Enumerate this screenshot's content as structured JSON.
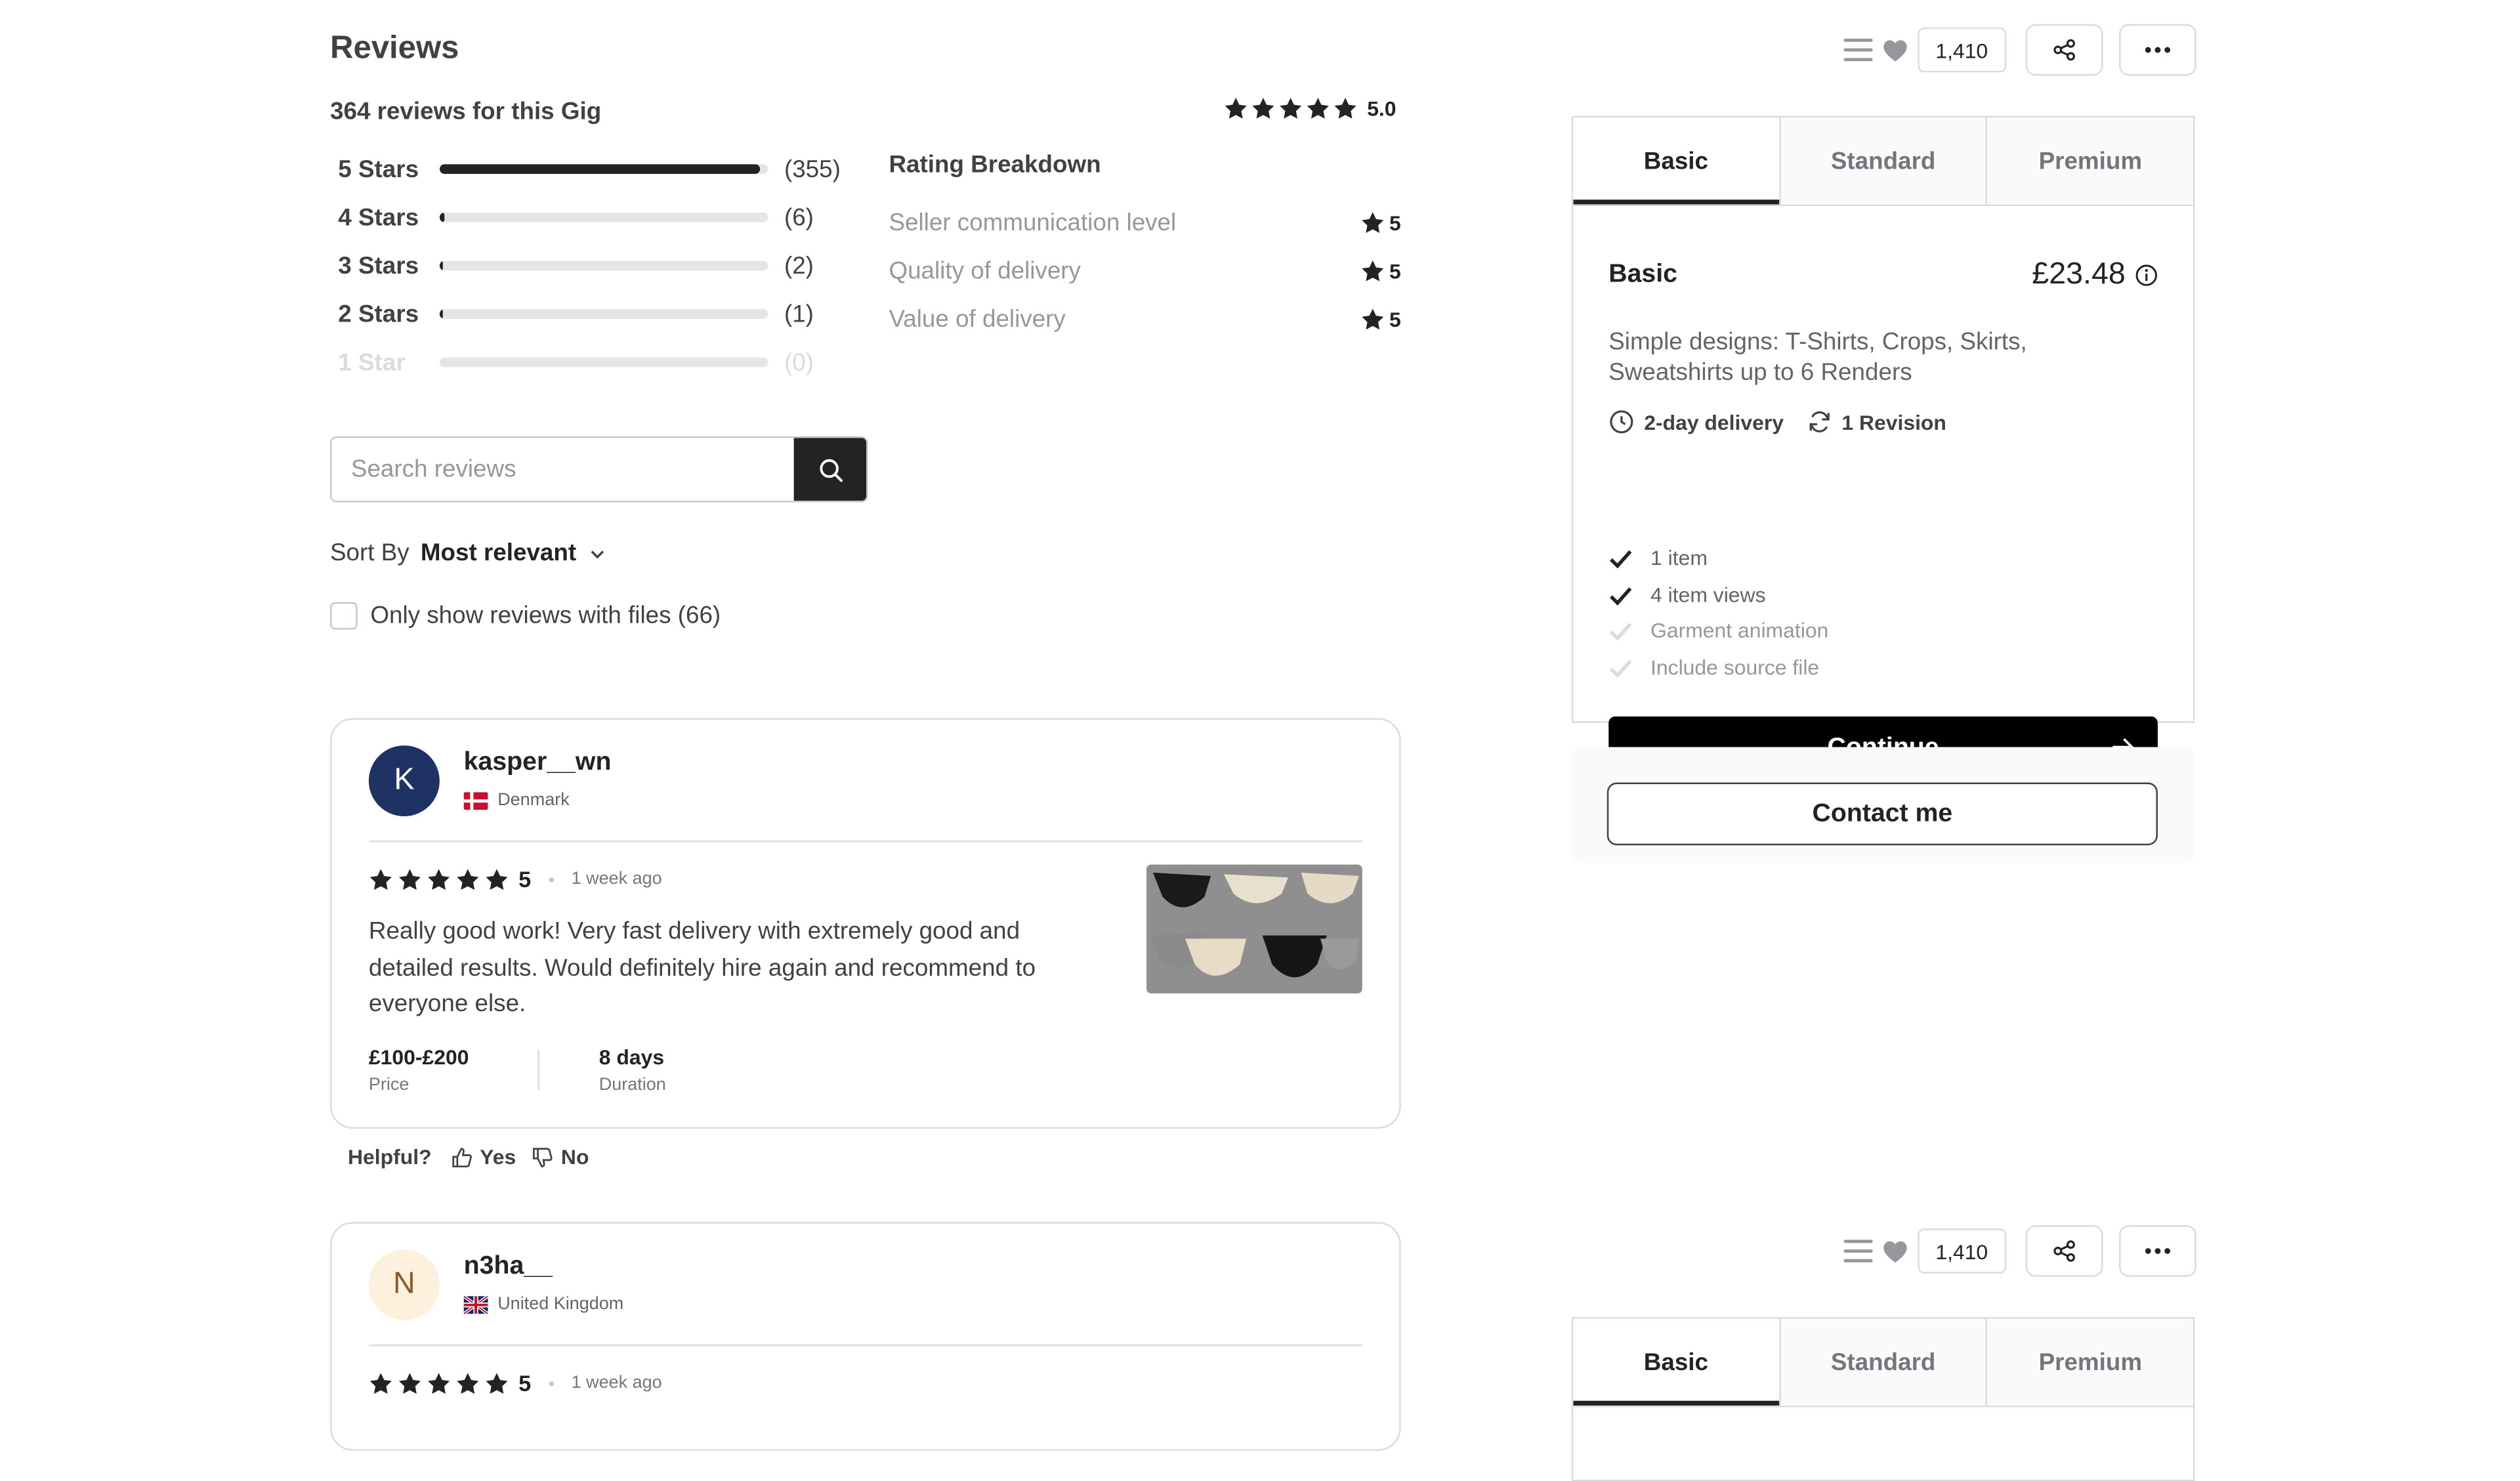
{
  "reviews": {
    "title": "Reviews",
    "count_text": "364 reviews for this Gig",
    "overall_rating": "5.0",
    "star_bars": [
      {
        "label": "5 Stars",
        "count": "(355)",
        "fraction": 0.975
      },
      {
        "label": "4 Stars",
        "count": "(6)",
        "fraction": 0.016
      },
      {
        "label": "3 Stars",
        "count": "(2)",
        "fraction": 0.006
      },
      {
        "label": "2 Stars",
        "count": "(1)",
        "fraction": 0.003
      },
      {
        "label": "1 Star",
        "count": "(0)",
        "fraction": 0
      }
    ],
    "breakdown": {
      "title": "Rating Breakdown",
      "items": [
        {
          "label": "Seller communication level",
          "score": "5"
        },
        {
          "label": "Quality of delivery",
          "score": "5"
        },
        {
          "label": "Value of delivery",
          "score": "5"
        }
      ]
    },
    "search": {
      "placeholder": "Search reviews"
    },
    "sort": {
      "label": "Sort By",
      "value": "Most relevant"
    },
    "filter_files": {
      "label": "Only show reviews with files (66)",
      "checked": false
    },
    "items": [
      {
        "initial": "K",
        "username": "kasper__wn",
        "country": "Denmark",
        "rating": "5",
        "time": "1 week ago",
        "text": "Really good work! Very fast delivery with extremely good and detailed results. Would definitely hire again and recommend to everyone else.",
        "price_value": "£100-£200",
        "price_label": "Price",
        "duration_value": "8 days",
        "duration_label": "Duration",
        "avatar_color": "#1e3264"
      },
      {
        "initial": "N",
        "username": "n3ha__",
        "country": "United Kingdom",
        "rating": "5",
        "time": "1 week ago",
        "avatar_color": "#fdf0dc"
      }
    ],
    "helpful": {
      "label": "Helpful?",
      "yes": "Yes",
      "no": "No"
    }
  },
  "actions": {
    "likes": "1,410"
  },
  "package": {
    "tabs": [
      "Basic",
      "Standard",
      "Premium"
    ],
    "active_tab": "Basic",
    "name": "Basic",
    "price": "£23.48",
    "description": "Simple designs: T-Shirts, Crops, Skirts, Sweatshirts up to 6 Renders",
    "delivery": "2-day delivery",
    "revisions": "1 Revision",
    "features": [
      {
        "label": "1 item",
        "included": true
      },
      {
        "label": "4 item views",
        "included": true
      },
      {
        "label": "Garment animation",
        "included": false
      },
      {
        "label": "Include source file",
        "included": false
      }
    ],
    "continue_label": "Continue",
    "contact_label": "Contact me"
  }
}
